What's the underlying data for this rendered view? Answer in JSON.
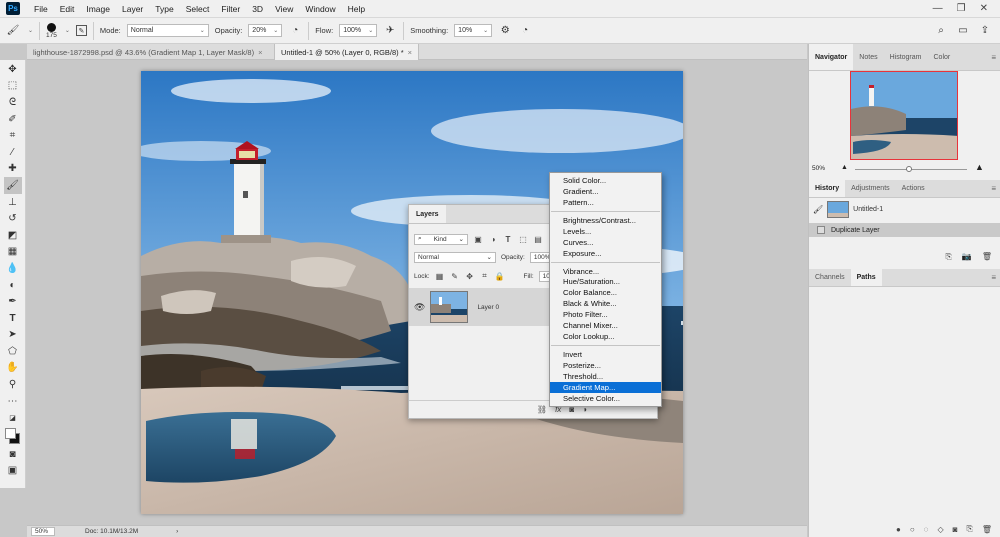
{
  "menu": {
    "items": [
      "File",
      "Edit",
      "Image",
      "Layer",
      "Type",
      "Select",
      "Filter",
      "3D",
      "View",
      "Window",
      "Help"
    ]
  },
  "options_bar": {
    "brush_size": "175",
    "mode_label": "Mode:",
    "mode_value": "Normal",
    "opacity_label": "Opacity:",
    "opacity_value": "20%",
    "flow_label": "Flow:",
    "flow_value": "100%",
    "smoothing_label": "Smoothing:",
    "smoothing_value": "10%"
  },
  "tabs": [
    {
      "label": "lighthouse-1872998.psd @ 43.6% (Gradient Map 1, Layer Mask/8)",
      "close": "×",
      "active": false
    },
    {
      "label": "Untitled-1 @ 50% (Layer 0, RGB/8) *",
      "close": "×",
      "active": true
    }
  ],
  "status": {
    "zoom": "50%",
    "doc": "Doc: 10.1M/13.2M",
    "arrow": "›"
  },
  "navigator": {
    "tabs": [
      "Navigator",
      "Notes",
      "Histogram",
      "Color"
    ],
    "zoom": "50%"
  },
  "history": {
    "tabs": [
      "History",
      "Adjustments",
      "Actions"
    ],
    "items": [
      "Untitled-1",
      "Duplicate Layer"
    ]
  },
  "channels": {
    "tabs": [
      "Channels",
      "Paths"
    ]
  },
  "layers_panel": {
    "title": "Layers",
    "filter_kind": "Kind",
    "blend_mode": "Normal",
    "opacity_label": "Opacity:",
    "opacity_value": "100%",
    "lock_label": "Lock:",
    "fill_label": "Fill:",
    "fill_value": "100%",
    "layer_name": "Layer 0",
    "fx_label": "fx"
  },
  "adjustment_menu": {
    "groups": [
      [
        "Solid Color...",
        "Gradient...",
        "Pattern..."
      ],
      [
        "Brightness/Contrast...",
        "Levels...",
        "Curves...",
        "Exposure..."
      ],
      [
        "Vibrance...",
        "Hue/Saturation...",
        "Color Balance...",
        "Black & White...",
        "Photo Filter...",
        "Channel Mixer...",
        "Color Lookup..."
      ],
      [
        "Invert",
        "Posterize...",
        "Threshold...",
        "Gradient Map...",
        "Selective Color..."
      ]
    ],
    "highlighted": "Gradient Map..."
  },
  "colors": {
    "highlight": "#0a6fd6",
    "panel_bg": "#f0f0f0",
    "workspace_bg": "#c8c8c8",
    "navigator_frame": "#e8333a"
  }
}
